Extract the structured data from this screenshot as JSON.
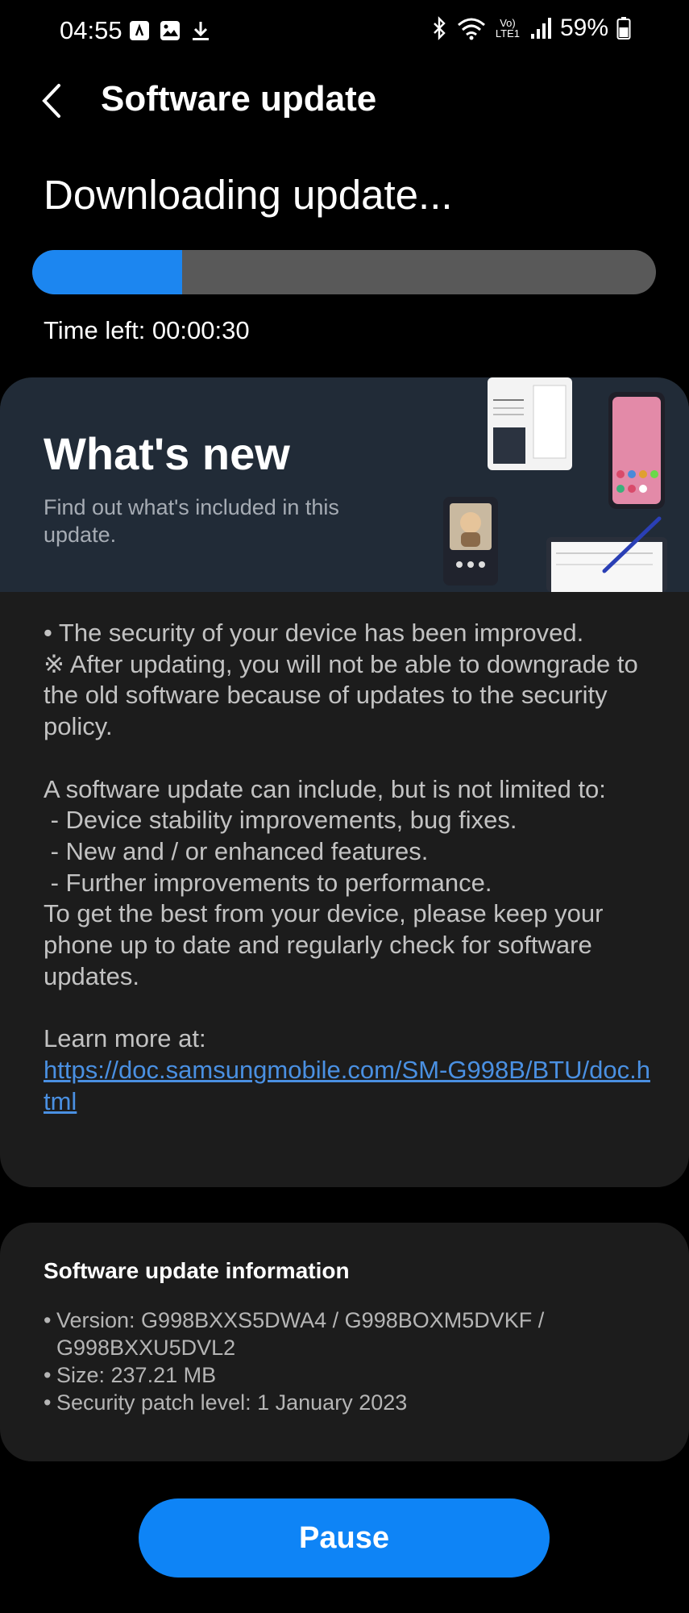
{
  "status_bar": {
    "time": "04:55",
    "battery": "59%",
    "network_label": "Vo) LTE1",
    "icons": [
      "media-icon",
      "image-icon",
      "download-icon",
      "bluetooth-icon",
      "wifi-icon",
      "volte-icon",
      "signal-icon",
      "battery-icon"
    ]
  },
  "header": {
    "title": "Software update",
    "back_icon": "chevron-left-icon"
  },
  "download": {
    "title": "Downloading update...",
    "progress": 0.24,
    "time_left": "Time left: 00:00:30"
  },
  "whats_new": {
    "heading": "What's new",
    "subtitle": "Find out what's included in this update.",
    "notes": {
      "line1": "• The security of your device has been improved.",
      "line2": "※ After updating, you will not be able to downgrade to the old software because of updates to the security policy.",
      "line3": "A software update can include, but is not limited to:",
      "line4": " - Device stability improvements, bug fixes.",
      "line5": " - New and / or enhanced features.",
      "line6": " - Further improvements to performance.",
      "line7": "To get the best from your device, please keep your phone up to date and regularly check for software updates.",
      "learn_more": "Learn more at:",
      "link": "https://doc.samsungmobile.com/SM-G998B/BTU/doc.html"
    }
  },
  "info": {
    "title": "Software update information",
    "version": "Version: G998BXXS5DWA4 / G998BOXM5DVKF / G998BXXU5DVL2",
    "size": "Size: 237.21 MB",
    "security_patch": "Security patch level: 1 January 2023"
  },
  "actions": {
    "pause": "Pause"
  },
  "colors": {
    "background": "#000000",
    "card": "#1c1c1c",
    "banner": "#212b37",
    "accent": "#0e84f6",
    "progress_track": "#595959",
    "link": "#4a90e2"
  }
}
